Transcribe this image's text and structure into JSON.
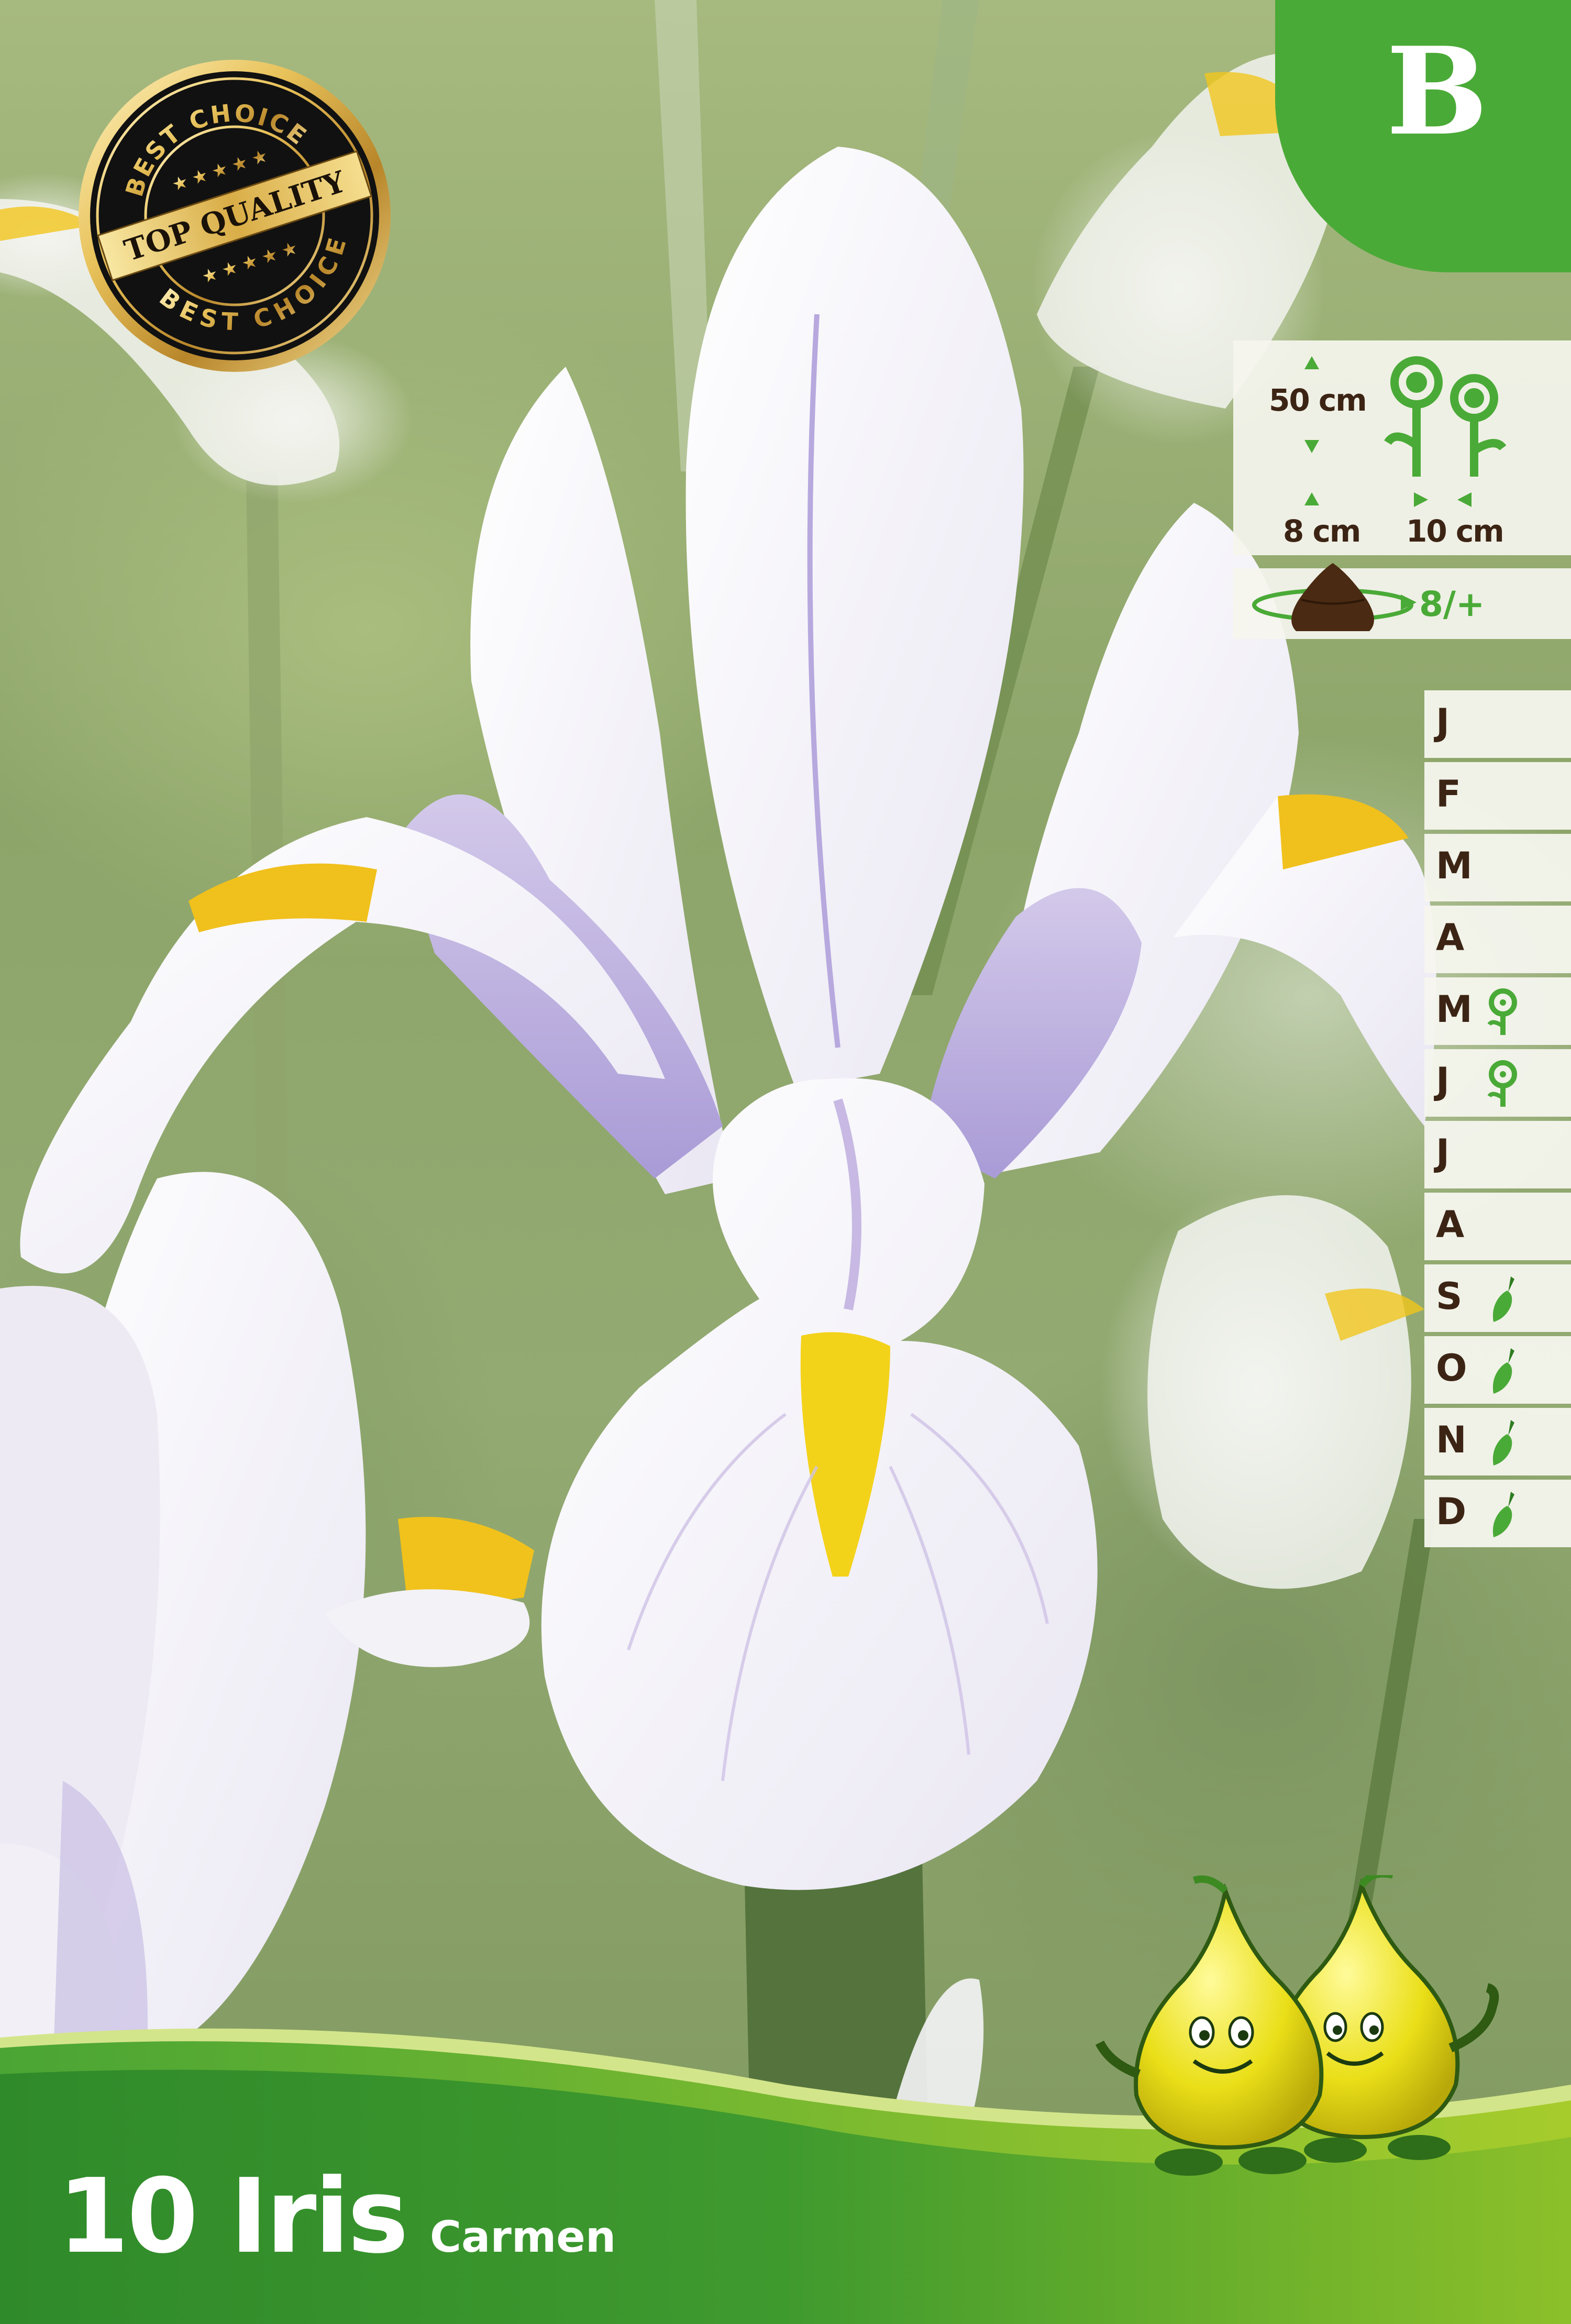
{
  "size_class": "B",
  "seal": {
    "top_text": "BEST CHOICE",
    "center_text": "TOP QUALITY",
    "bottom_text": "BEST CHOICE"
  },
  "info": {
    "height": "50 cm",
    "depth": "8 cm",
    "spacing": "10 cm",
    "bulb_size": "8/+"
  },
  "calendar": [
    {
      "label": "J",
      "icon": ""
    },
    {
      "label": "F",
      "icon": ""
    },
    {
      "label": "M",
      "icon": ""
    },
    {
      "label": "A",
      "icon": ""
    },
    {
      "label": "M",
      "icon": "flower-icon"
    },
    {
      "label": "J",
      "icon": "flower-icon"
    },
    {
      "label": "J",
      "icon": ""
    },
    {
      "label": "A",
      "icon": ""
    },
    {
      "label": "S",
      "icon": "trowel-icon"
    },
    {
      "label": "O",
      "icon": "trowel-icon"
    },
    {
      "label": "N",
      "icon": "trowel-icon"
    },
    {
      "label": "D",
      "icon": "trowel-icon"
    }
  ],
  "product": {
    "title": "10 Iris",
    "variety": "Carmen"
  },
  "colors": {
    "brand_green": "#4aaa37",
    "text_brown": "#3c2414",
    "panel_bg": "#f5f5ee"
  }
}
